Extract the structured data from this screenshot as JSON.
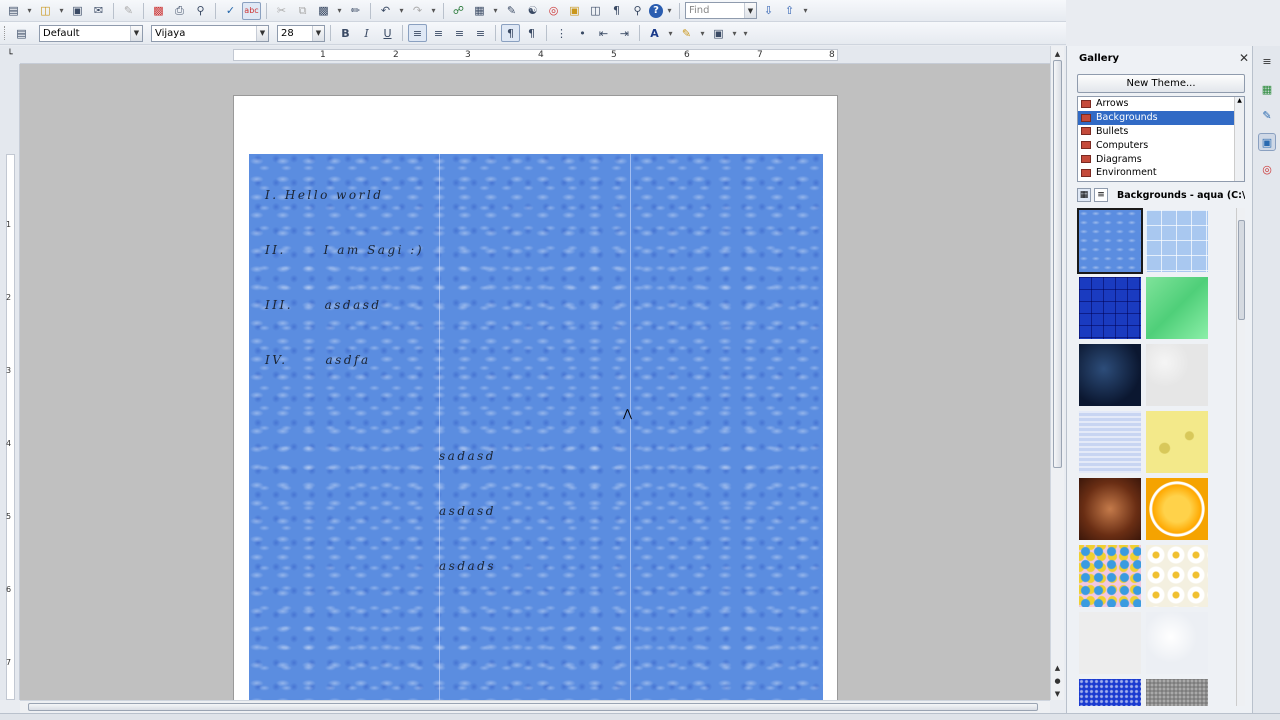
{
  "toolbar": {
    "find_placeholder": "Find"
  },
  "format": {
    "style": "Default",
    "font": "Vijaya",
    "size": "28",
    "bold": "B",
    "italic": "I",
    "underline": "U"
  },
  "ruler": {
    "numbers": [
      "1",
      "2",
      "3",
      "4",
      "5",
      "6",
      "7",
      "8"
    ],
    "vertical_numbers": [
      "1",
      "2",
      "3",
      "4",
      "5",
      "6",
      "7"
    ]
  },
  "document": {
    "lines": [
      "I. Hello world",
      "II.      I am Sagi :)",
      "III.     asdasd",
      "IV.      asdfa"
    ],
    "column2_lines": [
      "sadasd",
      "asdasd",
      "asdads"
    ]
  },
  "gallery": {
    "title": "Gallery",
    "new_theme": "New Theme...",
    "themes": [
      "Arrows",
      "Backgrounds",
      "Bullets",
      "Computers",
      "Diagrams",
      "Environment"
    ],
    "selected_theme": "Backgrounds",
    "path": "Backgrounds - aqua (C:\\Pr",
    "thumbnails": [
      "aqua",
      "blue-tiles",
      "blue-squares",
      "green-water",
      "dark-blue",
      "white-paper",
      "blue-texture",
      "cheese",
      "chocolate",
      "orange",
      "candy",
      "daisies",
      "white-paper-2",
      "white-texture",
      "blue-sparkle",
      "grey-stone"
    ]
  }
}
